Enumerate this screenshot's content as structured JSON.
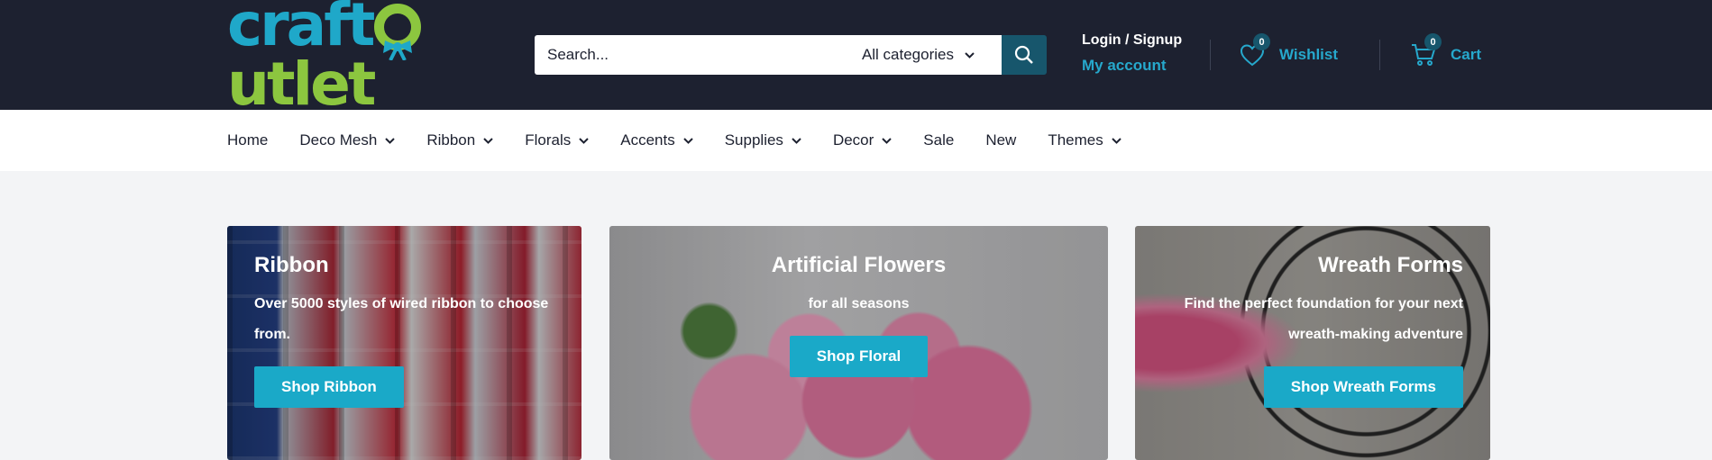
{
  "brand": {
    "logo_part1": "craft",
    "logo_part2": "utlet",
    "logo_letter_o": "o"
  },
  "search": {
    "placeholder": "Search...",
    "category": "All categories"
  },
  "account": {
    "login_label": "Login / Signup",
    "account_label": "My account"
  },
  "wishlist": {
    "label": "Wishlist",
    "count": "0"
  },
  "cart": {
    "label": "Cart",
    "count": "0"
  },
  "nav": [
    {
      "label": "Home",
      "dropdown": false
    },
    {
      "label": "Deco Mesh",
      "dropdown": true
    },
    {
      "label": "Ribbon",
      "dropdown": true
    },
    {
      "label": "Florals",
      "dropdown": true
    },
    {
      "label": "Accents",
      "dropdown": true
    },
    {
      "label": "Supplies",
      "dropdown": true
    },
    {
      "label": "Decor",
      "dropdown": true
    },
    {
      "label": "Sale",
      "dropdown": false
    },
    {
      "label": "New",
      "dropdown": false
    },
    {
      "label": "Themes",
      "dropdown": true
    }
  ],
  "promos": [
    {
      "title": "Ribbon",
      "subtitle": "Over 5000 styles of wired ribbon to choose from.",
      "button": "Shop Ribbon"
    },
    {
      "title": "Artificial Flowers",
      "subtitle": "for all seasons",
      "button": "Shop Floral"
    },
    {
      "title": "Wreath Forms",
      "subtitle": "Find the perfect foundation for your next wreath-making adventure",
      "button": "Shop Wreath Forms"
    }
  ],
  "colors": {
    "header_bg": "#1d2130",
    "accent": "#1aa9c8",
    "brand_green": "#8cc63f",
    "search_button": "#17566c"
  }
}
